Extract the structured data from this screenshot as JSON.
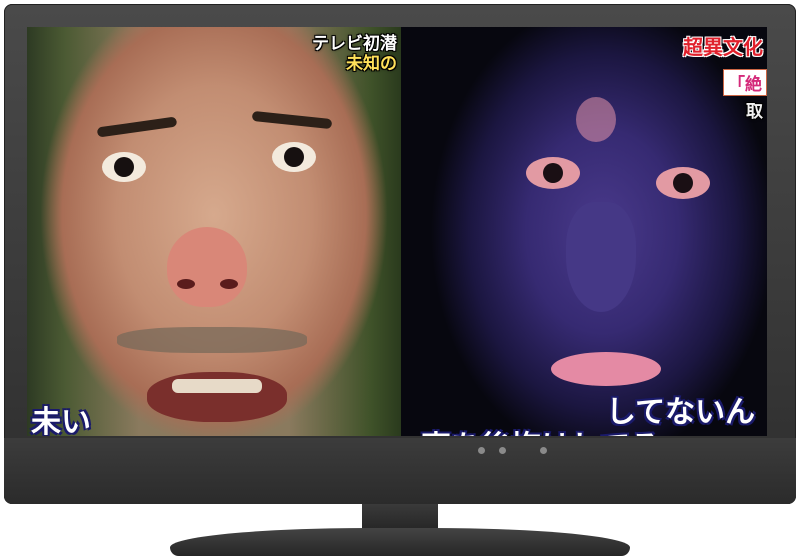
{
  "scene": {
    "left_captions": {
      "top_line1": "テレビ初潜",
      "top_line2": "未知の",
      "bottom": "未い"
    },
    "right_captions": {
      "top_title": "超異文化",
      "top_box": "「絶",
      "top_sub": "取",
      "subtitle_line1": "してないん",
      "subtitle_line2": "事を後悔はしてる"
    }
  },
  "colors": {
    "bezel": "#333333",
    "caption_yellow": "#ffe15a",
    "caption_red": "#e0202c"
  },
  "icons": [
    "tv-led-indicator",
    "tv-led-indicator",
    "tv-led-indicator"
  ]
}
